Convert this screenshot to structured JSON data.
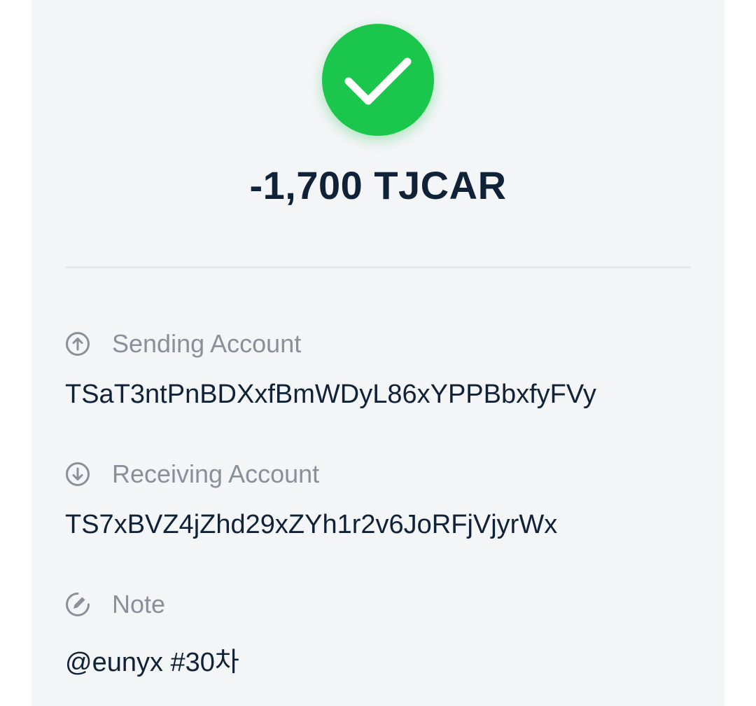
{
  "status_icon": "checkmark-icon",
  "colors": {
    "success": "#1bc64c",
    "text_primary": "#0f2237",
    "text_secondary": "#8a9099"
  },
  "transaction": {
    "amount": "-1,700 TJCAR"
  },
  "details": {
    "sending": {
      "icon": "arrow-up-circle-icon",
      "label": "Sending Account",
      "value": "TSaT3ntPnBDXxfBmWDyL86xYPPBbxfyFVy"
    },
    "receiving": {
      "icon": "arrow-down-circle-icon",
      "label": "Receiving Account",
      "value": "TS7xBVZ4jZhd29xZYh1r2v6JoRFjVjyrWx"
    },
    "note": {
      "icon": "pencil-circle-icon",
      "label": "Note",
      "value": "@eunyx #30차"
    }
  }
}
